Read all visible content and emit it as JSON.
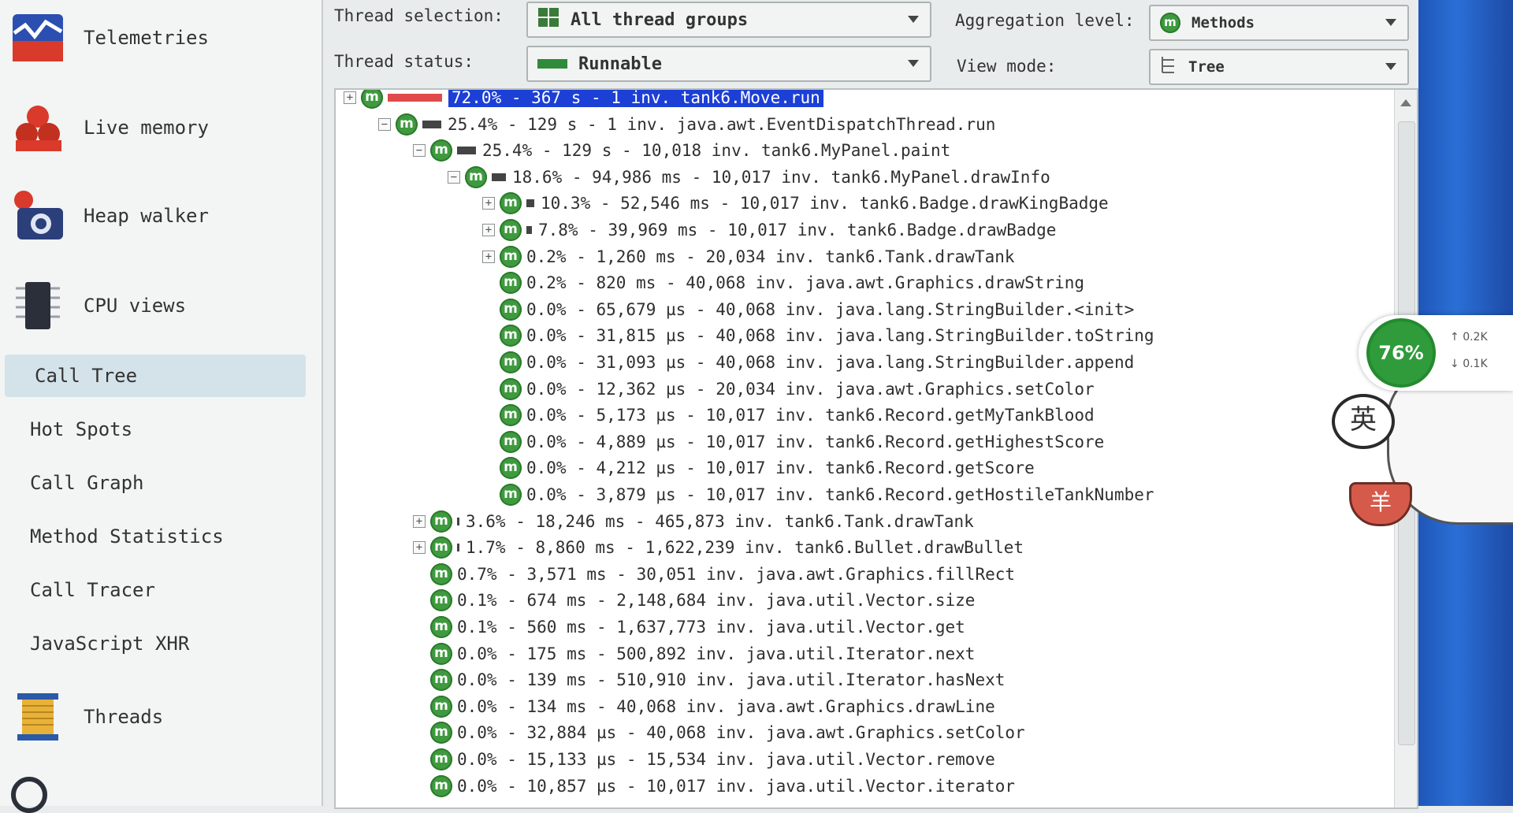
{
  "sidebar": {
    "nav_items": [
      {
        "label": "Telemetries",
        "icon": "telemetries-icon"
      },
      {
        "label": "Live memory",
        "icon": "live-memory-icon"
      },
      {
        "label": "Heap walker",
        "icon": "heap-walker-icon"
      },
      {
        "label": "CPU views",
        "icon": "cpu-views-icon"
      }
    ],
    "cpu_sub_items": [
      {
        "label": "Call Tree",
        "active": true
      },
      {
        "label": "Hot Spots"
      },
      {
        "label": "Call Graph"
      },
      {
        "label": "Method Statistics"
      },
      {
        "label": "Call Tracer"
      },
      {
        "label": "JavaScript XHR"
      }
    ],
    "threads": {
      "label": "Threads",
      "icon": "threads-icon"
    }
  },
  "header": {
    "thread_selection_label": "Thread selection:",
    "thread_selection_value": "All thread groups",
    "thread_status_label": "Thread status:",
    "thread_status_value": "Runnable",
    "aggregation_label": "Aggregation level:",
    "aggregation_value": "Methods",
    "view_mode_label": "View mode:",
    "view_mode_value": "Tree"
  },
  "tree": {
    "rows": [
      {
        "text": "72.0% - 367 s - 1 inv. tank6.Move.run",
        "percent": 72.0,
        "expander": "+",
        "selected": true
      },
      {
        "text": "25.4% - 129 s - 1 inv. java.awt.EventDispatchThread.run",
        "percent": 25.4,
        "expander": "-"
      },
      {
        "text": "25.4% - 129 s - 10,018 inv. tank6.MyPanel.paint",
        "percent": 25.4,
        "expander": "-"
      },
      {
        "text": "18.6% - 94,986 ms - 10,017 inv. tank6.MyPanel.drawInfo",
        "percent": 18.6,
        "expander": "-"
      },
      {
        "text": "10.3% - 52,546 ms - 10,017 inv. tank6.Badge.drawKingBadge",
        "percent": 10.3,
        "expander": "+"
      },
      {
        "text": "7.8% - 39,969 ms - 10,017 inv. tank6.Badge.drawBadge",
        "percent": 7.8,
        "expander": "+"
      },
      {
        "text": "0.2% - 1,260 ms - 20,034 inv. tank6.Tank.drawTank",
        "percent": 0.2,
        "expander": "+"
      },
      {
        "text": "0.2% - 820 ms - 40,068 inv. java.awt.Graphics.drawString",
        "percent": 0.2,
        "expander": ""
      },
      {
        "text": "0.0% - 65,679 µs - 40,068 inv. java.lang.StringBuilder.<init>",
        "percent": 0.0,
        "expander": ""
      },
      {
        "text": "0.0% - 31,815 µs - 40,068 inv. java.lang.StringBuilder.toString",
        "percent": 0.0,
        "expander": ""
      },
      {
        "text": "0.0% - 31,093 µs - 40,068 inv. java.lang.StringBuilder.append",
        "percent": 0.0,
        "expander": ""
      },
      {
        "text": "0.0% - 12,362 µs - 20,034 inv. java.awt.Graphics.setColor",
        "percent": 0.0,
        "expander": ""
      },
      {
        "text": "0.0% - 5,173 µs - 10,017 inv. tank6.Record.getMyTankBlood",
        "percent": 0.0,
        "expander": ""
      },
      {
        "text": "0.0% - 4,889 µs - 10,017 inv. tank6.Record.getHighestScore",
        "percent": 0.0,
        "expander": ""
      },
      {
        "text": "0.0% - 4,212 µs - 10,017 inv. tank6.Record.getScore",
        "percent": 0.0,
        "expander": ""
      },
      {
        "text": "0.0% - 3,879 µs - 10,017 inv. tank6.Record.getHostileTankNumber",
        "percent": 0.0,
        "expander": ""
      },
      {
        "text": "3.6% - 18,246 ms - 465,873 inv. tank6.Tank.drawTank",
        "percent": 3.6,
        "expander": "+"
      },
      {
        "text": "1.7% - 8,860 ms - 1,622,239 inv. tank6.Bullet.drawBullet",
        "percent": 1.7,
        "expander": "+"
      },
      {
        "text": "0.7% - 3,571 ms - 30,051 inv. java.awt.Graphics.fillRect",
        "percent": 0.7,
        "expander": ""
      },
      {
        "text": "0.1% - 674 ms - 2,148,684 inv. java.util.Vector.size",
        "percent": 0.1,
        "expander": ""
      },
      {
        "text": "0.1% - 560 ms - 1,637,773 inv. java.util.Vector.get",
        "percent": 0.1,
        "expander": ""
      },
      {
        "text": "0.0% - 175 ms - 500,892 inv. java.util.Iterator.next",
        "percent": 0.0,
        "expander": ""
      },
      {
        "text": "0.0% - 139 ms - 510,910 inv. java.util.Iterator.hasNext",
        "percent": 0.0,
        "expander": ""
      },
      {
        "text": "0.0% - 134 ms - 40,068 inv. java.awt.Graphics.drawLine",
        "percent": 0.0,
        "expander": ""
      },
      {
        "text": "0.0% - 32,884 µs - 40,068 inv. java.awt.Graphics.setColor",
        "percent": 0.0,
        "expander": ""
      },
      {
        "text": "0.0% - 15,133 µs - 15,534 inv. java.util.Vector.remove",
        "percent": 0.0,
        "expander": ""
      },
      {
        "text": "0.0% - 10,857 µs - 10,017 inv. java.util.Vector.iterator",
        "percent": 0.0,
        "expander": ""
      }
    ]
  },
  "desktop_widget": {
    "gauge_value": "76%",
    "upload": "0.2K",
    "download": "0.1K",
    "mascot_bubble": "英",
    "mascot_bowl": "羊"
  },
  "colors": {
    "selection": "#1c3fd6",
    "method_icon": "#3f9a3f",
    "hot_bar": "#e04a4a",
    "sidebar_active": "#d4e3ea"
  }
}
